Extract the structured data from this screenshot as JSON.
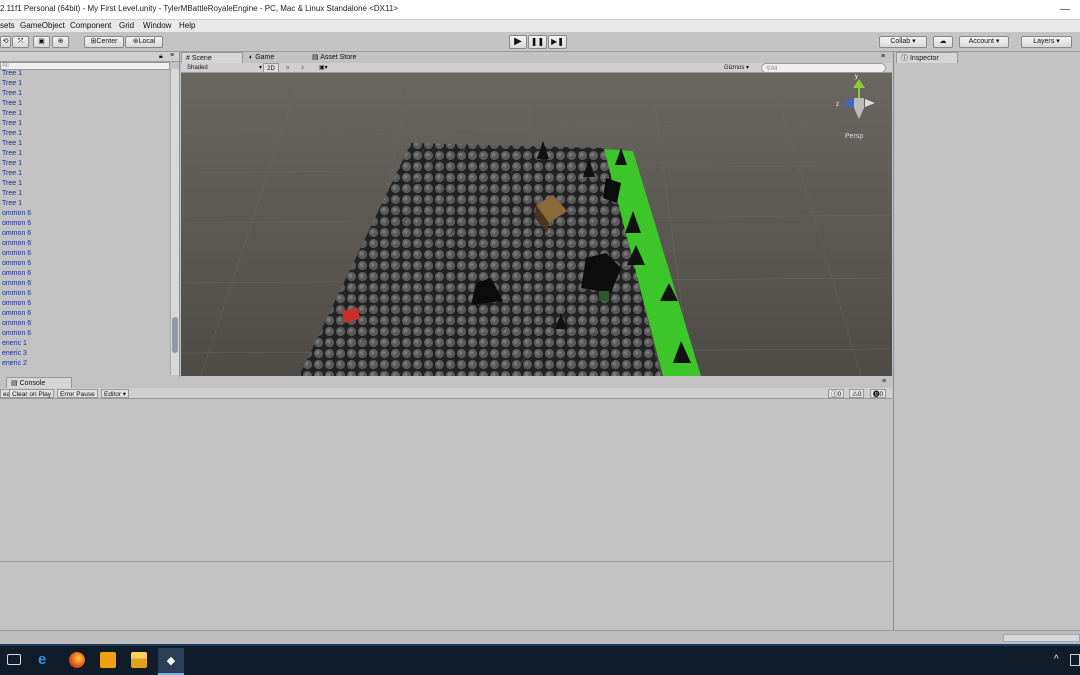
{
  "window": {
    "title": "2.11f1 Personal (64bit) - My First Level.unity - TylerMBattleRoyaleEngine - PC, Mac & Linux Standalone <DX11>",
    "controls": [
      "—",
      "☐",
      "✕"
    ]
  },
  "menu": [
    "sets",
    "GameObject",
    "Component",
    "Grid",
    "Window",
    "Help"
  ],
  "toolbar": {
    "pivot_label": "Center",
    "space_label": "Local",
    "play_label": "▶",
    "pause_label": "❚❚",
    "step_label": "▶❚",
    "collab_label": "Collab ▾",
    "account_label": "Account",
    "layers_label": "Layers"
  },
  "hierarchy": {
    "search_placeholder": "All",
    "items": [
      "Tree 1",
      "Tree 1",
      "Tree 1",
      "Tree 1",
      "Tree 1",
      "Tree 1",
      "Tree 1",
      "Tree 1",
      "Tree 1",
      "Tree 1",
      "Tree 1",
      "Tree 1",
      "Tree 1",
      "Tree 1",
      "ommon 6",
      "ommon 6",
      "ommon 6",
      "ommon 6",
      "ommon 6",
      "ommon 6",
      "ommon 6",
      "ommon 6",
      "ommon 6",
      "ommon 6",
      "ommon 6",
      "ommon 6",
      "ommon 6",
      "eneric 1",
      "eneric 3",
      "eneric 2"
    ]
  },
  "scene_tabs": [
    "Scene",
    "Game",
    "Asset Store"
  ],
  "scene_toolbar": {
    "shading": "Shaded",
    "mode_2d": "2D",
    "gizmos": "Gizmos ▾",
    "search_placeholder": "All"
  },
  "viewport": {
    "persp_label": "Persp",
    "axis_y": "y",
    "axis_z": "z"
  },
  "console": {
    "tab_label": "Console",
    "buttons": [
      "ear",
      "Clear on Play",
      "Error Pause",
      "Editor ▾"
    ],
    "counts": [
      "0",
      "0",
      "0"
    ]
  },
  "inspector": {
    "tab_label": "Inspector"
  },
  "taskbar": {
    "icons": [
      "task-view-icon",
      "edge-icon",
      "firefox-icon",
      "media-icon",
      "file-explorer-icon",
      "unity-icon"
    ],
    "tray": "^"
  }
}
